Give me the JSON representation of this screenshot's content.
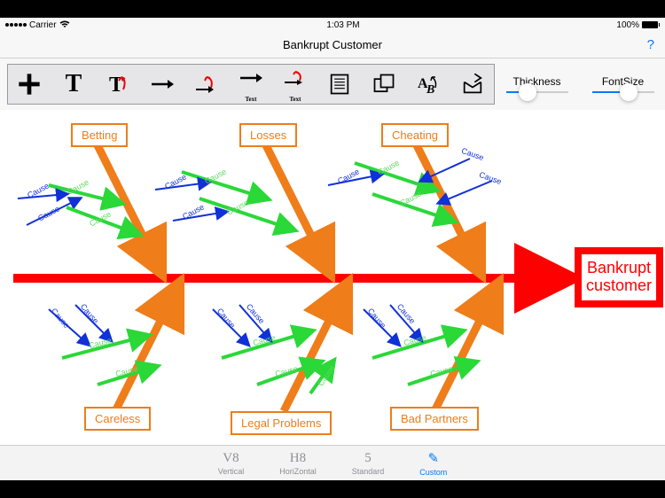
{
  "status": {
    "carrier": "Carrier",
    "time": "1:03 PM",
    "battery": "100%"
  },
  "nav": {
    "title": "Bankrupt Customer",
    "help": "?"
  },
  "sliders": {
    "thickness": "Thickness",
    "fontsize": "FontSize"
  },
  "effect": {
    "line1": "Bankrupt",
    "line2": "customer"
  },
  "categories": {
    "betting": "Betting",
    "losses": "Losses",
    "cheating": "Cheating",
    "careless": "Careless",
    "legal": "Legal Problems",
    "partners": "Bad Partners"
  },
  "cause_label": "Cause",
  "tools": {
    "text_sub": "Text"
  },
  "tabs": {
    "vertical": "Vertical",
    "horizontal": "HoriZontal",
    "standard": "Standard",
    "custom": "Custom"
  },
  "chart_data": {
    "type": "fishbone",
    "effect": "Bankrupt customer",
    "categories": [
      {
        "name": "Betting",
        "position": "top",
        "causes": [
          "Cause",
          "Cause",
          "Cause"
        ]
      },
      {
        "name": "Losses",
        "position": "top",
        "causes": [
          "Cause",
          "Cause",
          "Cause"
        ]
      },
      {
        "name": "Cheating",
        "position": "top",
        "causes": [
          "Cause",
          "Cause",
          "Cause"
        ]
      },
      {
        "name": "Careless",
        "position": "bottom",
        "causes": [
          "Cause",
          "Cause",
          "Cause"
        ]
      },
      {
        "name": "Legal Problems",
        "position": "bottom",
        "causes": [
          "Cause",
          "Cause",
          "Cause"
        ]
      },
      {
        "name": "Bad Partners",
        "position": "bottom",
        "causes": [
          "Cause",
          "Cause",
          "Cause"
        ]
      }
    ]
  }
}
